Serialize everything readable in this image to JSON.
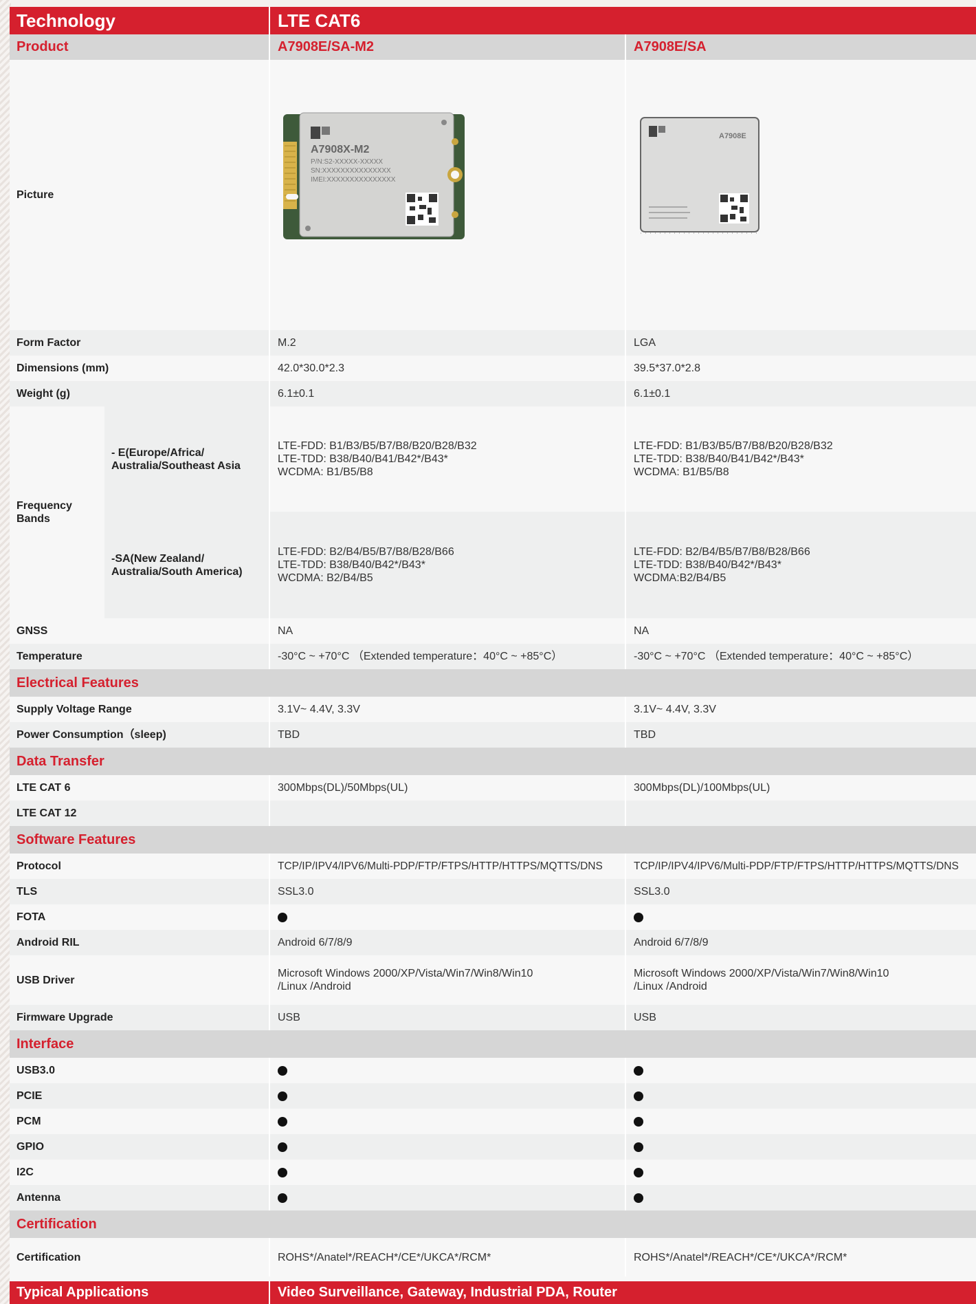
{
  "header": {
    "technology_label": "Technology",
    "technology_value": "LTE CAT6"
  },
  "product": {
    "label": "Product",
    "col1": "A7908E/SA-M2",
    "col2": "A7908E/SA"
  },
  "picture": {
    "label": "Picture",
    "m2_module": {
      "brand": "SIMCom",
      "model": "A7908X-M2",
      "pn": "P/N:S2-XXXXX-XXXXX",
      "sn": "SN:XXXXXXXXXXXXXXX",
      "imei": "IMEI:XXXXXXXXXXXXXXX"
    },
    "lga_module": {
      "brand": "SIMCom",
      "model": "A7908E"
    }
  },
  "specs": [
    {
      "label": "Form Factor",
      "col1": "M.2",
      "col2": "LGA"
    },
    {
      "label": "Dimensions (mm)",
      "col1": "42.0*30.0*2.3",
      "col2": "39.5*37.0*2.8"
    },
    {
      "label": "Weight (g)",
      "col1": "6.1±0.1",
      "col2": "6.1±0.1"
    }
  ],
  "frequency": {
    "label": "Frequency\nBands",
    "rows": [
      {
        "sub_label": "- E(Europe/Africa/\nAustralia/Southeast Asia",
        "col1": "LTE-FDD: B1/B3/B5/B7/B8/B20/B28/B32\nLTE-TDD: B38/B40/B41/B42*/B43*\nWCDMA: B1/B5/B8",
        "col2": "LTE-FDD: B1/B3/B5/B7/B8/B20/B28/B32\nLTE-TDD: B38/B40/B41/B42*/B43*\nWCDMA: B1/B5/B8"
      },
      {
        "sub_label": "-SA(New Zealand/\nAustralia/South America)",
        "col1": "LTE-FDD: B2/B4/B5/B7/B8/B28/B66\nLTE-TDD: B38/B40/B42*/B43*\nWCDMA: B2/B4/B5",
        "col2": "LTE-FDD: B2/B4/B5/B7/B8/B28/B66\nLTE-TDD: B38/B40/B42*/B43*\nWCDMA:B2/B4/B5"
      }
    ]
  },
  "gnss": {
    "label": "GNSS",
    "col1": "NA",
    "col2": "NA"
  },
  "temperature": {
    "label": "Temperature",
    "col1": "-30°C ~ +70°C （Extended temperature：40°C ~ +85°C）",
    "col2": "-30°C ~ +70°C （Extended temperature：40°C ~ +85°C）"
  },
  "electrical": {
    "title": "Electrical Features",
    "rows": [
      {
        "label": "Supply Voltage Range",
        "col1": "3.1V~ 4.4V, 3.3V",
        "col2": "3.1V~ 4.4V, 3.3V"
      },
      {
        "label": "Power Consumption（sleep)",
        "col1": "TBD",
        "col2": "TBD"
      }
    ]
  },
  "data_transfer": {
    "title": "Data Transfer",
    "rows": [
      {
        "label": "LTE CAT 6",
        "col1": "300Mbps(DL)/50Mbps(UL)",
        "col2": "300Mbps(DL)/100Mbps(UL)"
      },
      {
        "label": "LTE CAT 12",
        "col1": "",
        "col2": ""
      }
    ]
  },
  "software": {
    "title": "Software Features",
    "protocol": {
      "label": "Protocol",
      "col1": "TCP/IP/IPV4/IPV6/Multi-PDP/FTP/FTPS/HTTP/HTTPS/MQTTS/DNS",
      "col2": "TCP/IP/IPV4/IPV6/Multi-PDP/FTP/FTPS/HTTP/HTTPS/MQTTS/DNS"
    },
    "tls": {
      "label": "TLS",
      "col1": "SSL3.0",
      "col2": "SSL3.0"
    },
    "fota": {
      "label": "FOTA",
      "col1_supported": true,
      "col2_supported": true
    },
    "android": {
      "label": "Android RIL",
      "col1": "Android 6/7/8/9",
      "col2": "Android 6/7/8/9"
    },
    "usb_driver": {
      "label": "USB Driver",
      "col1": "Microsoft Windows 2000/XP/Vista/Win7/Win8/Win10\n/Linux /Android",
      "col2": "Microsoft Windows 2000/XP/Vista/Win7/Win8/Win10\n/Linux /Android"
    },
    "firmware": {
      "label": "Firmware Upgrade",
      "col1": "USB",
      "col2": "USB"
    }
  },
  "interface": {
    "title": "Interface",
    "rows": [
      {
        "label": "USB3.0"
      },
      {
        "label": "PCIE"
      },
      {
        "label": "PCM"
      },
      {
        "label": "GPIO"
      },
      {
        "label": "I2C"
      },
      {
        "label": "Antenna"
      }
    ]
  },
  "certification": {
    "title": "Certification",
    "label": "Certification",
    "col1": "ROHS*/Anatel*/REACH*/CE*/UKCA*/RCM*",
    "col2": "ROHS*/Anatel*/REACH*/CE*/UKCA*/RCM*"
  },
  "applications": {
    "label": "Typical Applications",
    "value": "Video Surveillance, Gateway, Industrial PDA, Router"
  },
  "colors": {
    "accent": "#d5202e",
    "section_bg": "#d6d6d6",
    "row_alt": "#eeefef"
  }
}
